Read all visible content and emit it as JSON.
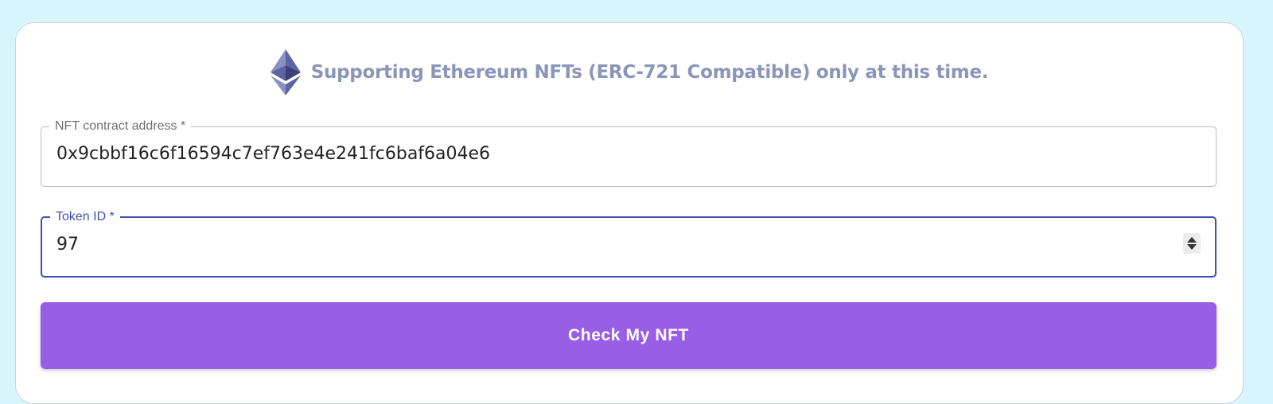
{
  "notice": {
    "icon": "ethereum-icon",
    "text": "Supporting Ethereum NFTs (ERC-721 Compatible) only at this time."
  },
  "form": {
    "contract_address": {
      "label": "NFT contract address *",
      "value": "0x9cbbf16c6f16594c7ef763e4e241fc6baf6a04e6"
    },
    "token_id": {
      "label": "Token ID *",
      "value": "97"
    },
    "submit_label": "Check My NFT"
  },
  "colors": {
    "page_background": "#d8f5fd",
    "accent_focus": "#3f51b5",
    "button": "#995ee6",
    "notice_text": "#8a95b8"
  }
}
